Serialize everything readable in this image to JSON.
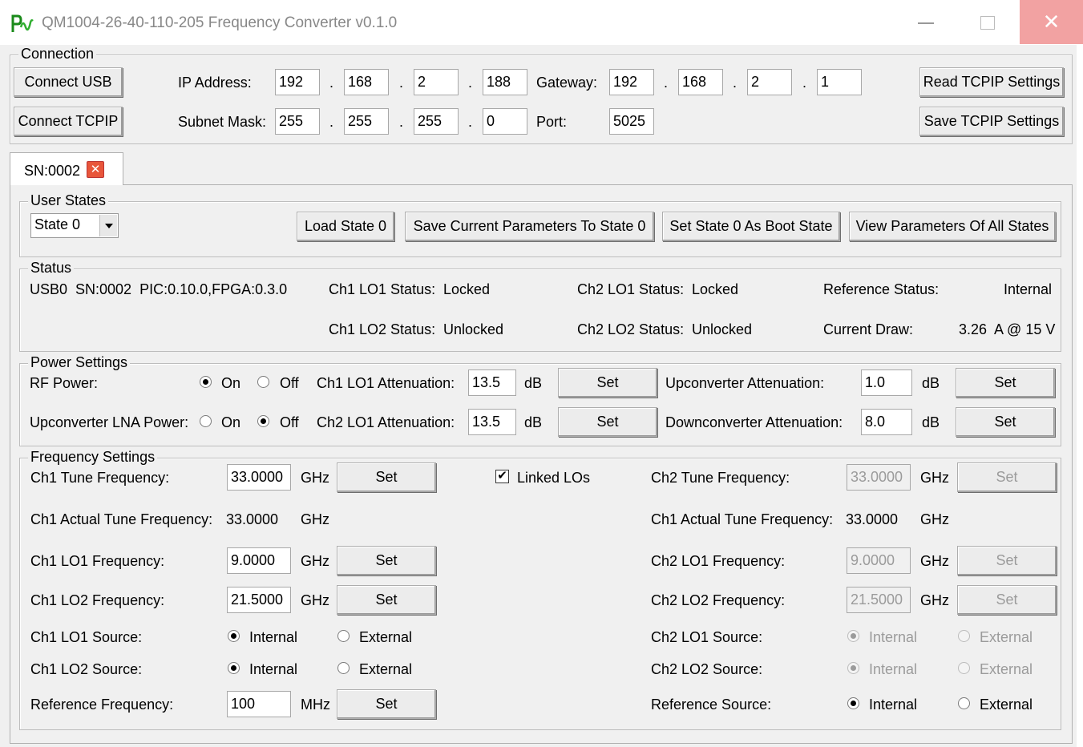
{
  "window": {
    "title": "QM1004-26-40-110-205 Frequency Converter v0.1.0",
    "close_glyph": "✕"
  },
  "connection": {
    "legend": "Connection",
    "connect_usb": "Connect USB",
    "connect_tcpip": "Connect TCPIP",
    "ip_label": "IP Address:",
    "ip": [
      "192",
      "168",
      "2",
      "188"
    ],
    "gateway_label": "Gateway:",
    "gateway": [
      "192",
      "168",
      "2",
      "1"
    ],
    "subnet_label": "Subnet Mask:",
    "subnet": [
      "255",
      "255",
      "255",
      "0"
    ],
    "port_label": "Port:",
    "port": "5025",
    "dot": ".",
    "read_tcpip": "Read TCPIP Settings",
    "save_tcpip": "Save TCPIP Settings"
  },
  "tab": {
    "label": "SN:0002",
    "close_glyph": "✕"
  },
  "user_states": {
    "legend": "User States",
    "selected_state": "State 0",
    "load": "Load State 0",
    "save": "Save Current Parameters To State 0",
    "boot": "Set State 0 As Boot State",
    "view": "View Parameters Of All States"
  },
  "status": {
    "legend": "Status",
    "device": "USB0  SN:0002  PIC:0.10.0,FPGA:0.3.0",
    "ch1_lo1_label": "Ch1 LO1 Status:",
    "ch1_lo1_value": "Locked",
    "ch1_lo2_label": "Ch1 LO2 Status:",
    "ch1_lo2_value": "Unlocked",
    "ch2_lo1_label": "Ch2 LO1 Status:",
    "ch2_lo1_value": "Locked",
    "ch2_lo2_label": "Ch2 LO2 Status:",
    "ch2_lo2_value": "Unlocked",
    "ref_label": "Reference Status:",
    "ref_value": "Internal",
    "current_label": "Current Draw:",
    "current_value": "3.26  A @ 15 V"
  },
  "power": {
    "legend": "Power Settings",
    "rf_power_label": "RF Power:",
    "lna_label": "Upconverter LNA Power:",
    "on": "On",
    "off": "Off",
    "ch1_lo1_att_label": "Ch1 LO1 Attenuation:",
    "ch1_lo1_att": "13.5",
    "ch2_lo1_att_label": "Ch2 LO1 Attenuation:",
    "ch2_lo1_att": "13.5",
    "up_att_label": "Upconverter Attenuation:",
    "up_att": "1.0",
    "down_att_label": "Downconverter Attenuation:",
    "down_att": "8.0",
    "db": "dB",
    "set": "Set"
  },
  "freq": {
    "legend": "Frequency Settings",
    "ch1_tune_label": "Ch1 Tune Frequency:",
    "ch1_tune": "33.0000",
    "ch1_actual_label": "Ch1 Actual Tune Frequency:",
    "ch1_actual": "33.0000",
    "ch1_lo1_label": "Ch1 LO1 Frequency:",
    "ch1_lo1": "9.0000",
    "ch1_lo2_label": "Ch1 LO2 Frequency:",
    "ch1_lo2": "21.5000",
    "ch1_lo1_src_label": "Ch1 LO1 Source:",
    "ch1_lo2_src_label": "Ch1 LO2 Source:",
    "ref_freq_label": "Reference Frequency:",
    "ref_freq": "100",
    "linked_los": "Linked LOs",
    "check_glyph": "✔",
    "ch2_tune_label": "Ch2 Tune Frequency:",
    "ch2_tune": "33.0000",
    "ch2_actual_label": "Ch1 Actual Tune Frequency:",
    "ch2_actual": "33.0000",
    "ch2_lo1_label": "Ch2 LO1 Frequency:",
    "ch2_lo1": "9.0000",
    "ch2_lo2_label": "Ch2 LO2 Frequency:",
    "ch2_lo2": "21.5000",
    "ch2_lo1_src_label": "Ch2 LO1 Source:",
    "ch2_lo2_src_label": "Ch2 LO2 Source:",
    "ref_src_label": "Reference Source:",
    "ghz": "GHz",
    "mhz": "MHz",
    "set": "Set",
    "internal": "Internal",
    "external": "External"
  }
}
